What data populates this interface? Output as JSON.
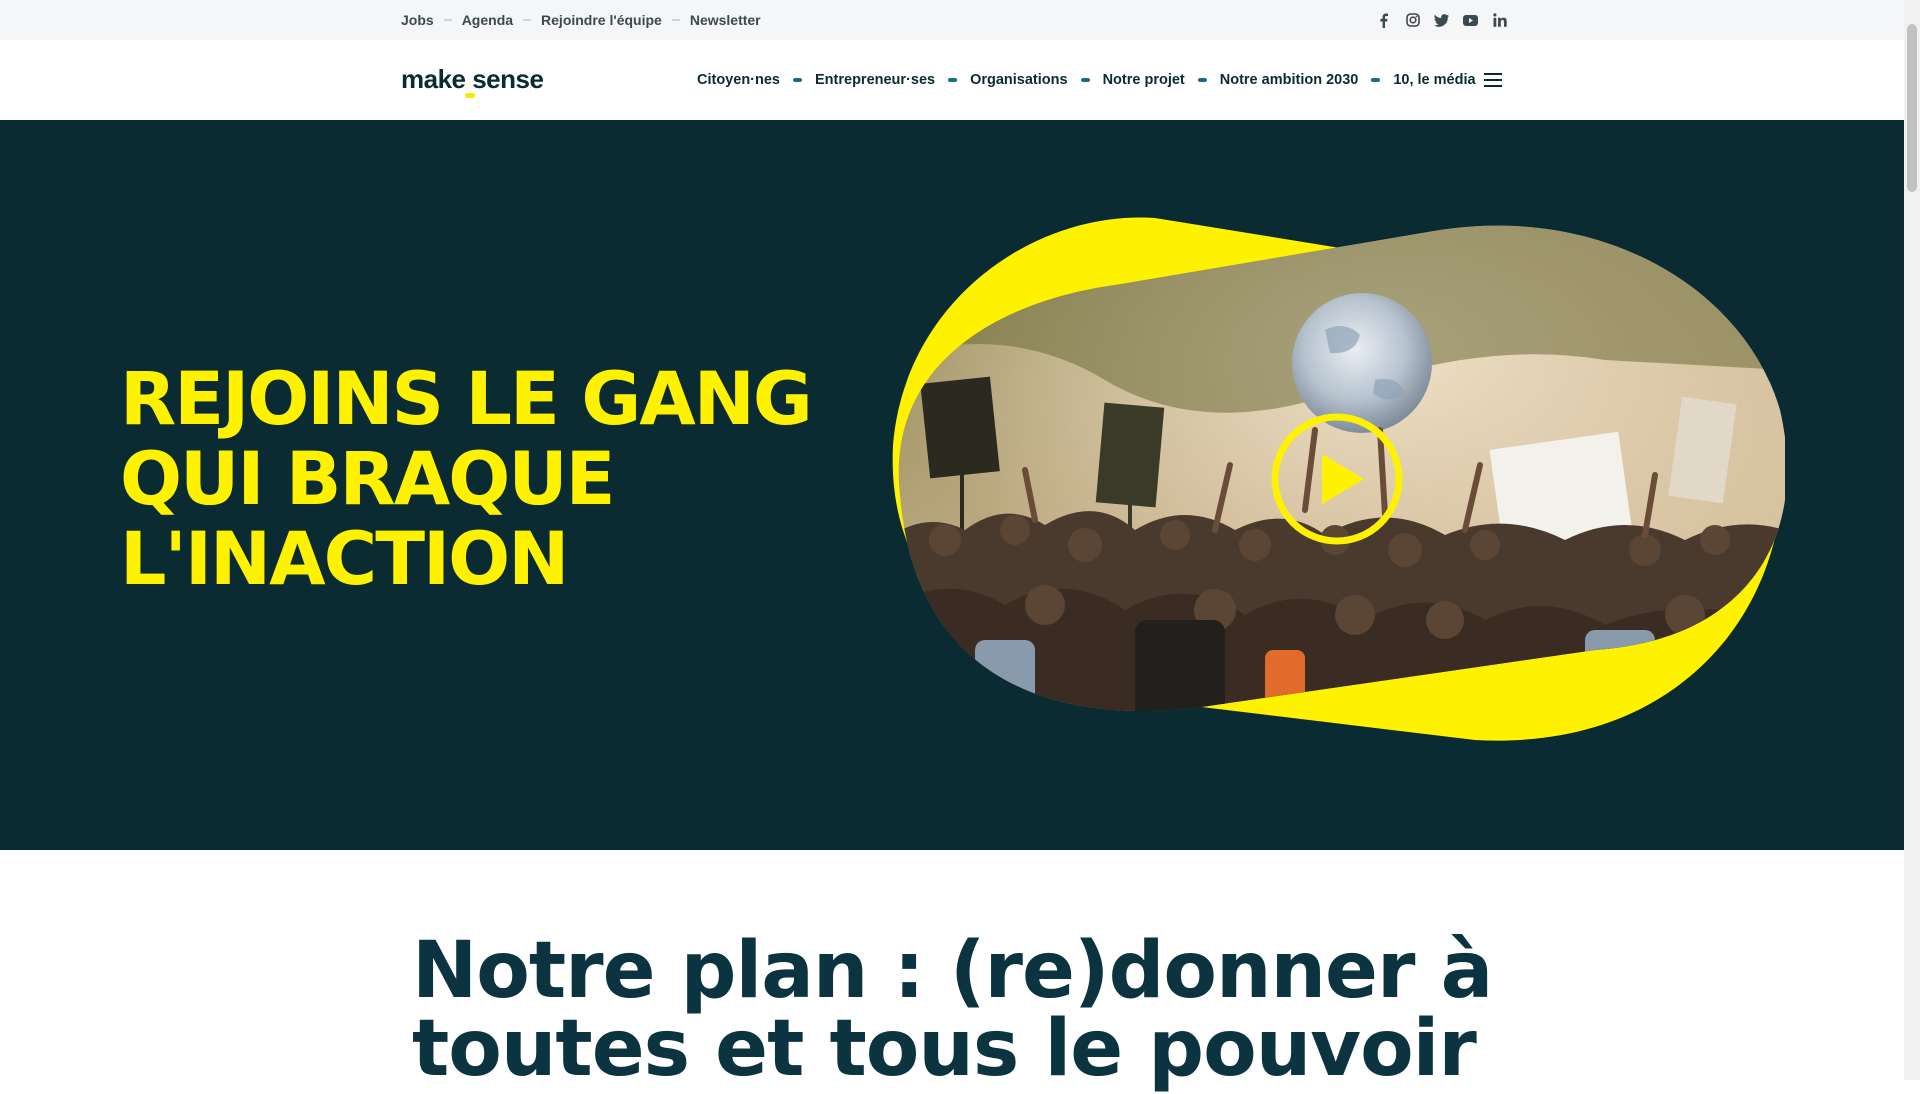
{
  "topbar": {
    "links": [
      "Jobs",
      "Agenda",
      "Rejoindre l'équipe",
      "Newsletter"
    ],
    "social_icons": [
      "facebook-icon",
      "instagram-icon",
      "twitter-icon",
      "youtube-icon",
      "linkedin-icon"
    ]
  },
  "header": {
    "logo": "make sense",
    "nav": [
      "Citoyen·nes",
      "Entrepreneur·ses",
      "Organisations",
      "Notre projet",
      "Notre ambition 2030",
      "10, le média"
    ],
    "menu_icon": "hamburger-menu-icon"
  },
  "hero": {
    "title_lines": [
      "REJOINS LE GANG",
      "QUI BRAQUE",
      "L'INACTION"
    ],
    "media_icon": "play-icon"
  },
  "section": {
    "title": "Notre plan : (re)donner à toutes et tous le pouvoir"
  },
  "colors": {
    "brand_dark": "#0b2b33",
    "brand_yellow": "#fff200",
    "nav_accent": "#1a6f88"
  }
}
